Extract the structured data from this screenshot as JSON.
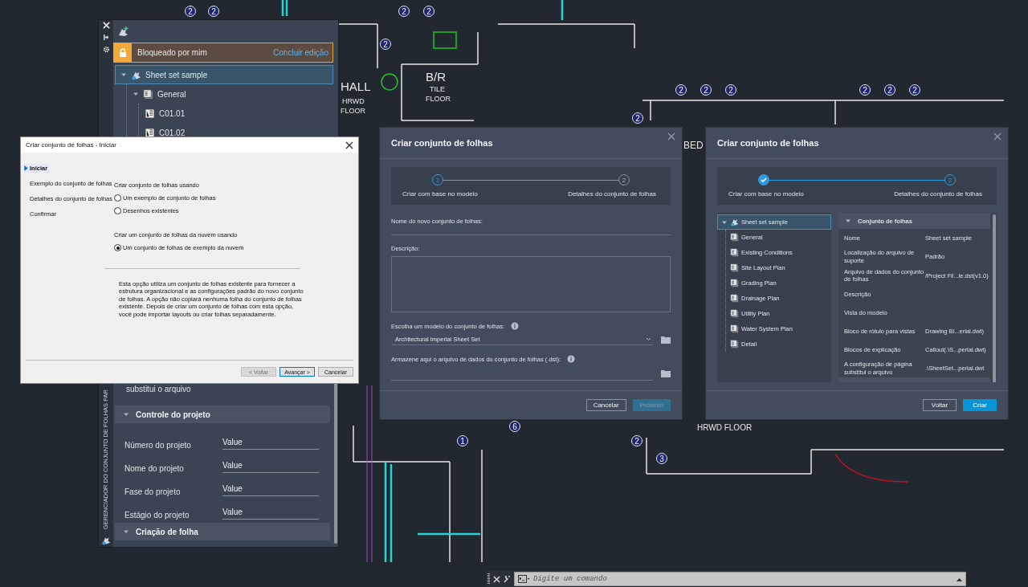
{
  "plan": {
    "labels": [
      "HALL",
      "HRWD",
      "FLOOR",
      "B/R",
      "TILE",
      "FLOOR",
      "BED",
      "HRWD FLOOR"
    ],
    "tags": [
      "2",
      "2",
      "2",
      "2",
      "2",
      "2",
      "2",
      "2",
      "2",
      "2",
      "2",
      "2",
      "2",
      "1",
      "6",
      "3"
    ]
  },
  "palette": {
    "title": "GERENCIADOR DO CONJUNTO DE FOLHAS PAR",
    "lock_banner": {
      "text": "Bloqueado por mim",
      "action": "Concluir edição"
    },
    "tree": [
      {
        "label": "Sheet set sample",
        "selected": true,
        "expanded": true,
        "children": [
          {
            "label": "General",
            "selected": false,
            "expanded": true,
            "children": [
              {
                "label": "C01.01",
                "selected": false
              },
              {
                "label": "C01.02",
                "selected": false
              }
            ]
          }
        ]
      }
    ],
    "partial_property": "substitui o arquivo",
    "sections": [
      {
        "title": "Controle do projeto",
        "expanded": true,
        "rows": [
          {
            "label": "Número do projeto",
            "value": "Value"
          },
          {
            "label": "Nome do projeto",
            "value": "Value"
          },
          {
            "label": "Fase do projeto",
            "value": "Value"
          },
          {
            "label": "Estágio do projeto",
            "value": "Value"
          }
        ]
      },
      {
        "title": "Criação de folha",
        "expanded": true
      }
    ]
  },
  "wizard": {
    "title": "Criar conjunto de folhas - Iniciar",
    "steps": [
      {
        "label": "Iniciar",
        "selected": true
      },
      {
        "label": "Exemplo do conjunto de folhas",
        "selected": false
      },
      {
        "label": "Detalhes do conjunto de folhas",
        "selected": false
      },
      {
        "label": "Confirmar",
        "selected": false
      }
    ],
    "groups": [
      {
        "label": "Criar conjunto de folhas usando",
        "options": [
          {
            "label": "Um exemplo de conjunto de folhas",
            "selected": false
          },
          {
            "label": "Desenhos existentes",
            "selected": false
          }
        ]
      },
      {
        "label": "Criar um conjunto de folhas da nuvem usando",
        "options": [
          {
            "label": "Um conjunto de folhas de exemplo da nuvem",
            "selected": true
          }
        ]
      }
    ],
    "description": "Esta opção utiliza um conjunto de folhas existente para fornecer a estrutura organizacional e as configurações padrão do novo conjunto de folhas. A opção não copiará nenhuma folha do conjunto de folhas existente. Depois de criar um conjunto de folhas com esta opção, você pode importar layouts ou criar folhas separadamente.",
    "buttons": [
      {
        "label": "< Voltar",
        "disabled": true,
        "default": false
      },
      {
        "label": "Avançar >",
        "disabled": false,
        "default": true
      },
      {
        "label": "Cancelar",
        "disabled": false,
        "default": false
      }
    ]
  },
  "dialog_template": {
    "title": "Criar conjunto de folhas",
    "steps": [
      {
        "number": "1",
        "label": "Criar com base no modelo",
        "done": false,
        "active": true
      },
      {
        "number": "2",
        "label": "Detalhes do conjunto de folhas",
        "done": false,
        "active": false
      }
    ],
    "name_label": "Nome do novo conjunto de folhas:",
    "description_label": "Descrição:",
    "template_label": "Escolha um modelo do conjunto de folhas:",
    "template_value": "Architectural Imperial Sheet Set",
    "storage_label": "Armazene aqui o arquivo de dados do conjunto de folhas (.dst):",
    "buttons": [
      {
        "label": "Cancelar",
        "kind": "secondary",
        "disabled": false
      },
      {
        "label": "Próximo",
        "kind": "primary",
        "disabled": true
      }
    ]
  },
  "dialog_details": {
    "title": "Criar conjunto de folhas",
    "steps": [
      {
        "label": "Criar com base no modelo",
        "done": true
      },
      {
        "number": "2",
        "label": "Detalhes do conjunto de folhas",
        "done": false,
        "active": true
      }
    ],
    "tree": [
      {
        "label": "Sheet set sample",
        "selected": true,
        "expanded": true,
        "children": [
          {
            "label": "General",
            "selected": false
          },
          {
            "label": "Existing Conditions",
            "selected": false
          },
          {
            "label": "Site Layout Plan",
            "selected": false
          },
          {
            "label": "Grading Plan",
            "selected": false
          },
          {
            "label": "Drainage Plan",
            "selected": false
          },
          {
            "label": "Utility Plan",
            "selected": false
          },
          {
            "label": "Water System Plan",
            "selected": false
          },
          {
            "label": "Detail",
            "selected": false
          }
        ]
      }
    ],
    "properties": {
      "section": "Conjunto de folhas",
      "expanded": true,
      "rows": [
        {
          "label": "Nome",
          "value": "Sheet set sample"
        },
        {
          "label": "Localização do arquivo de suporte",
          "value": "Padrão"
        },
        {
          "label": "Arquivo de dados do conjunto de folhas",
          "value": "/Project Fil...le.dst(v1.0)"
        },
        {
          "label": "Descrição"
        },
        {
          "label": "Vista do modelo"
        },
        {
          "label": "Bloco de rótulo para vistas",
          "value": "Drawing Bl...erial.dwt)"
        },
        {
          "label": "Blocos de explicação",
          "value": "Callout(.\\S...perial.dwt)"
        },
        {
          "label": "A configuração de página substitui o arquivo",
          "value": ".\\SheetSet...perial.dwt"
        }
      ]
    },
    "buttons": [
      {
        "label": "Voltar",
        "kind": "secondary",
        "disabled": false
      },
      {
        "label": "Criar",
        "kind": "primary",
        "disabled": false
      }
    ]
  },
  "command_line": {
    "placeholder": "Digite um comando"
  }
}
